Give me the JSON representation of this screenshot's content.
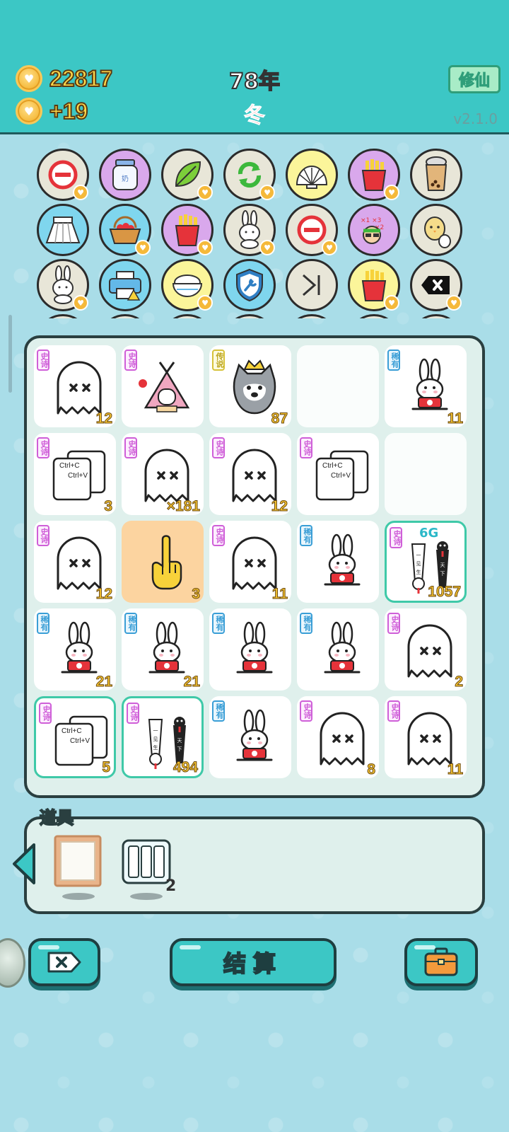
{
  "header": {
    "coins": "22817",
    "income": "+19",
    "year": "78年",
    "season": "冬",
    "mode_button": "修仙",
    "version": "v2.1.0"
  },
  "icon_grid": [
    {
      "icon": "minus-circle-icon",
      "bg": "#e8e6d8",
      "heart": true
    },
    {
      "icon": "milk-jar-icon",
      "bg": "#d9a8ec",
      "heart": false
    },
    {
      "icon": "leaf-icon",
      "bg": "#e8e6d8",
      "heart": true
    },
    {
      "icon": "refresh-icon",
      "bg": "#e8e6d8",
      "heart": true
    },
    {
      "icon": "shell-icon",
      "bg": "#fbf59a",
      "heart": false
    },
    {
      "icon": "fries-icon",
      "bg": "#d9a8ec",
      "heart": true
    },
    {
      "icon": "bubble-tea-icon",
      "bg": "#e8e6d8",
      "heart": false
    },
    {
      "icon": "skirt-icon",
      "bg": "#7fd6ee",
      "heart": false
    },
    {
      "icon": "fruit-basket-icon",
      "bg": "#7fd6ee",
      "heart": true
    },
    {
      "icon": "fries-icon",
      "bg": "#d9a8ec",
      "heart": true
    },
    {
      "icon": "rabbit-icon",
      "bg": "#e8e6d8",
      "heart": true
    },
    {
      "icon": "minus-circle-icon",
      "bg": "#e8e6d8",
      "heart": true
    },
    {
      "icon": "glasses-man-icon",
      "bg": "#d9a8ec",
      "heart": false
    },
    {
      "icon": "chick-egg-icon",
      "bg": "#e8e6d8",
      "heart": false
    },
    {
      "icon": "rabbit-icon",
      "bg": "#e8e6d8",
      "heart": true
    },
    {
      "icon": "printer-icon",
      "bg": "#7fd6ee",
      "heart": false
    },
    {
      "icon": "rice-bowl-icon",
      "bg": "#fbf59a",
      "heart": true
    },
    {
      "icon": "shield-wrench-icon",
      "bg": "#7fd6ee",
      "heart": false
    },
    {
      "icon": "skip-icon",
      "bg": "#e8e6d8",
      "heart": false
    },
    {
      "icon": "fries-icon",
      "bg": "#fbf59a",
      "heart": true
    },
    {
      "icon": "delete-tag-icon",
      "bg": "#e8e6d8",
      "heart": true
    }
  ],
  "board": [
    [
      {
        "tag": "史诗",
        "rarity": "epic",
        "art": "ghost",
        "count": "12"
      },
      {
        "tag": "史诗",
        "rarity": "epic",
        "art": "rabbit-house",
        "count": ""
      },
      {
        "tag": "传说",
        "rarity": "legend",
        "art": "husky-king",
        "count": "87"
      },
      {
        "tag": "",
        "rarity": "",
        "art": "empty",
        "count": ""
      },
      {
        "tag": "稀有",
        "rarity": "rare",
        "art": "rabbit",
        "count": "11"
      }
    ],
    [
      {
        "tag": "史诗",
        "rarity": "epic",
        "art": "ctrl-cv",
        "count": "3"
      },
      {
        "tag": "史诗",
        "rarity": "epic",
        "art": "ghost",
        "count": "×181"
      },
      {
        "tag": "史诗",
        "rarity": "epic",
        "art": "ghost",
        "count": "12"
      },
      {
        "tag": "史诗",
        "rarity": "epic",
        "art": "ctrl-cv",
        "count": ""
      },
      {
        "tag": "",
        "rarity": "",
        "art": "empty",
        "count": ""
      }
    ],
    [
      {
        "tag": "史诗",
        "rarity": "epic",
        "art": "ghost",
        "count": "12"
      },
      {
        "tag": "",
        "rarity": "",
        "art": "finger",
        "count": "3"
      },
      {
        "tag": "史诗",
        "rarity": "epic",
        "art": "ghost",
        "count": "11"
      },
      {
        "tag": "稀有",
        "rarity": "rare",
        "art": "rabbit",
        "count": ""
      },
      {
        "tag": "史诗",
        "rarity": "epic",
        "art": "wuchang",
        "count": "1057",
        "extra": "6G",
        "highlight": true
      }
    ],
    [
      {
        "tag": "稀有",
        "rarity": "rare",
        "art": "rabbit",
        "count": "21"
      },
      {
        "tag": "稀有",
        "rarity": "rare",
        "art": "rabbit",
        "count": "21"
      },
      {
        "tag": "稀有",
        "rarity": "rare",
        "art": "rabbit",
        "count": ""
      },
      {
        "tag": "稀有",
        "rarity": "rare",
        "art": "rabbit",
        "count": ""
      },
      {
        "tag": "史诗",
        "rarity": "epic",
        "art": "ghost",
        "count": "2"
      }
    ],
    [
      {
        "tag": "史诗",
        "rarity": "epic",
        "art": "ctrl-cv",
        "count": "5",
        "highlight": true
      },
      {
        "tag": "史诗",
        "rarity": "epic",
        "art": "wuchang",
        "count": "494",
        "highlight": true
      },
      {
        "tag": "稀有",
        "rarity": "rare",
        "art": "rabbit",
        "count": ""
      },
      {
        "tag": "史诗",
        "rarity": "epic",
        "art": "ghost",
        "count": "8"
      },
      {
        "tag": "史诗",
        "rarity": "epic",
        "art": "ghost",
        "count": "11"
      }
    ]
  ],
  "props": {
    "title": "道具",
    "items": [
      {
        "icon": "frame-icon",
        "count": ""
      },
      {
        "icon": "triple-slot-icon",
        "count": "2"
      }
    ]
  },
  "bottom": {
    "settle_label": "结算",
    "delete_icon": "delete-tag-icon",
    "bag_icon": "briefcase-icon"
  },
  "ctrl_text": {
    "line1": "Ctrl+C",
    "line2": "Ctrl+V"
  }
}
